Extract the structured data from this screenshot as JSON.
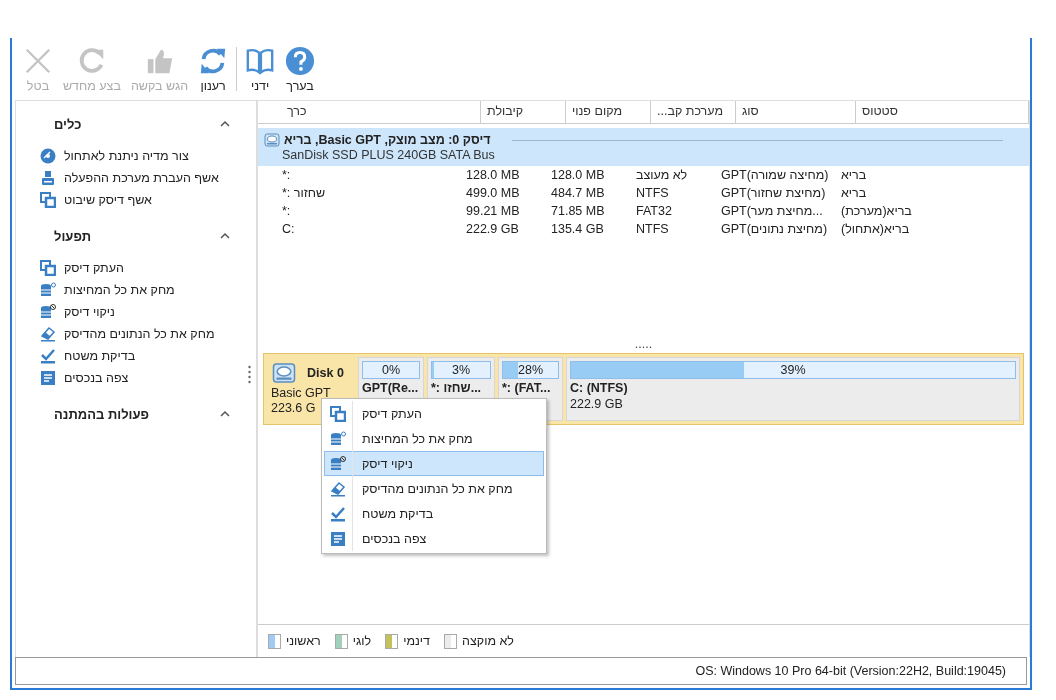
{
  "toolbar": {
    "groups": [
      [
        {
          "label": "בערך",
          "kind": "help",
          "disabled": false
        },
        {
          "label": "ידני",
          "kind": "manual",
          "disabled": false
        }
      ],
      [
        {
          "label": "רענון",
          "kind": "refresh",
          "disabled": false
        },
        {
          "label": "הגש בקשה",
          "kind": "apply",
          "disabled": true
        },
        {
          "label": "בצע מחדש",
          "kind": "redo",
          "disabled": true
        },
        {
          "label": "בטל",
          "kind": "cancel",
          "disabled": true
        }
      ]
    ]
  },
  "sidebar": {
    "sections": [
      {
        "title": "כלים",
        "expanded": true,
        "items": [
          {
            "label": "צור מדיה ניתנת לאתחול",
            "kind": "media"
          },
          {
            "label": "אשף העברת מערכת ההפעלה",
            "kind": "migrate"
          },
          {
            "label": "אשף דיסק שיבוט",
            "kind": "clone"
          }
        ]
      },
      {
        "title": "תפעול",
        "expanded": true,
        "items": [
          {
            "label": "העתק דיסק",
            "kind": "clone"
          },
          {
            "label": "מחק את כל המחיצות",
            "kind": "delete"
          },
          {
            "label": "ניקוי דיסק",
            "kind": "wipe"
          },
          {
            "label": "מחק את כל הנתונים מהדיסק",
            "kind": "erase"
          },
          {
            "label": "בדיקת משטח",
            "kind": "check"
          },
          {
            "label": "צפה בנכסים",
            "kind": "props"
          }
        ]
      },
      {
        "title": "פעולות בהמתנה",
        "expanded": true
      }
    ]
  },
  "table": {
    "columns": [
      "סטטוס",
      "סוג",
      "...מערכת קב",
      "מקום פנוי",
      "קיבולת",
      "כרך"
    ],
    "rows": [
      {
        "kind": "disk",
        "selected": true,
        "title": "דיסק 0: מצב מוצק, Basic GPT, בריא",
        "subtitle": "SanDisk SSD PLUS 240GB SATA Bus"
      },
      {
        "kind": "partition",
        "selected": false,
        "cells": [
          "בריא",
          "GPT(מחיצה שמורה)",
          "לא מעוצב",
          "128.0 MB",
          "128.0 MB",
          "*:"
        ]
      },
      {
        "kind": "partition",
        "selected": false,
        "cells": [
          "בריא",
          "GPT(מחיצת שחזור)",
          "NTFS",
          "484.7 MB",
          "499.0 MB",
          "*: שחזור"
        ]
      },
      {
        "kind": "partition",
        "selected": false,
        "cells": [
          "בריא(מערכת)",
          "GPT(מחיצת מער...",
          "FAT32",
          "71.85 MB",
          "99.21 MB",
          "*:"
        ]
      },
      {
        "kind": "partition",
        "selected": false,
        "cells": [
          "בריא(אתחול)",
          "GPT(מחיצת נתונים)",
          "NTFS",
          "135.4 GB",
          "222.9 GB",
          "C:"
        ]
      }
    ]
  },
  "splitter": ".....",
  "disk_map": {
    "selected": true,
    "name": "Disk 0",
    "type": "Basic GPT",
    "size": "223.6 G",
    "partitions": [
      {
        "usage": "39%",
        "level": 0.39,
        "label": "C: (NTFS)",
        "size": "222.9 GB"
      },
      {
        "usage": "28%",
        "level": 0.28,
        "label": "*: (FAT..."
      },
      {
        "usage": "3%",
        "level": 0.03,
        "label": "*: שחזו..."
      },
      {
        "usage": "0%",
        "level": 0,
        "label": "GPT(Re..."
      }
    ]
  },
  "context_menu": {
    "items": [
      {
        "label": "העתק דיסק",
        "kind": "clone",
        "selected": false
      },
      {
        "label": "מחק את כל המחיצות",
        "kind": "delete",
        "selected": false
      },
      {
        "label": "ניקוי דיסק",
        "kind": "wipe",
        "selected": true
      },
      {
        "label": "מחק את כל הנתונים מהדיסק",
        "kind": "erase",
        "selected": false
      },
      {
        "label": "בדיקת משטח",
        "kind": "check",
        "selected": false
      },
      {
        "label": "צפה בנכסים",
        "kind": "props",
        "selected": false
      }
    ]
  },
  "legend": [
    {
      "label": "לא מוקצה",
      "color": "#ececec"
    },
    {
      "label": "דינמי",
      "color": "#c4c25c"
    },
    {
      "label": "לוגי",
      "color": "#a3d0bd"
    },
    {
      "label": "ראשוני",
      "color": "#9fcbf4"
    }
  ],
  "status_bar": {
    "text": "OS: Windows 10 Pro 64-bit (Version:22H2, Build:19045)"
  }
}
